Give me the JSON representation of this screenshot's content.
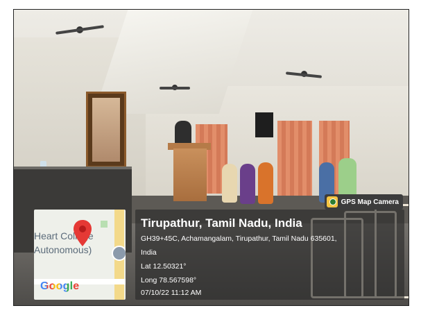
{
  "photo": {
    "description_icon": "auditorium-photo"
  },
  "overlay": {
    "app_badge": "GPS Map Camera",
    "location_title": "Tirupathur, Tamil Nadu, India",
    "address_line1": "GH39+45C, Achamangalam, Tirupathur, Tamil Nadu 635601,",
    "address_line2": "India",
    "latitude": "Lat 12.50321°",
    "longitude": "Long 78.567598°",
    "datetime": "07/10/22 11:12 AM"
  },
  "map": {
    "label_line1": "Heart College",
    "label_line2": "Autonomous)",
    "google_logo": "Google",
    "colors": {
      "pin": "#e53935",
      "google_blue": "#4285f4",
      "google_red": "#ea4335",
      "google_yellow": "#fbbc05",
      "google_green": "#34a853"
    }
  }
}
